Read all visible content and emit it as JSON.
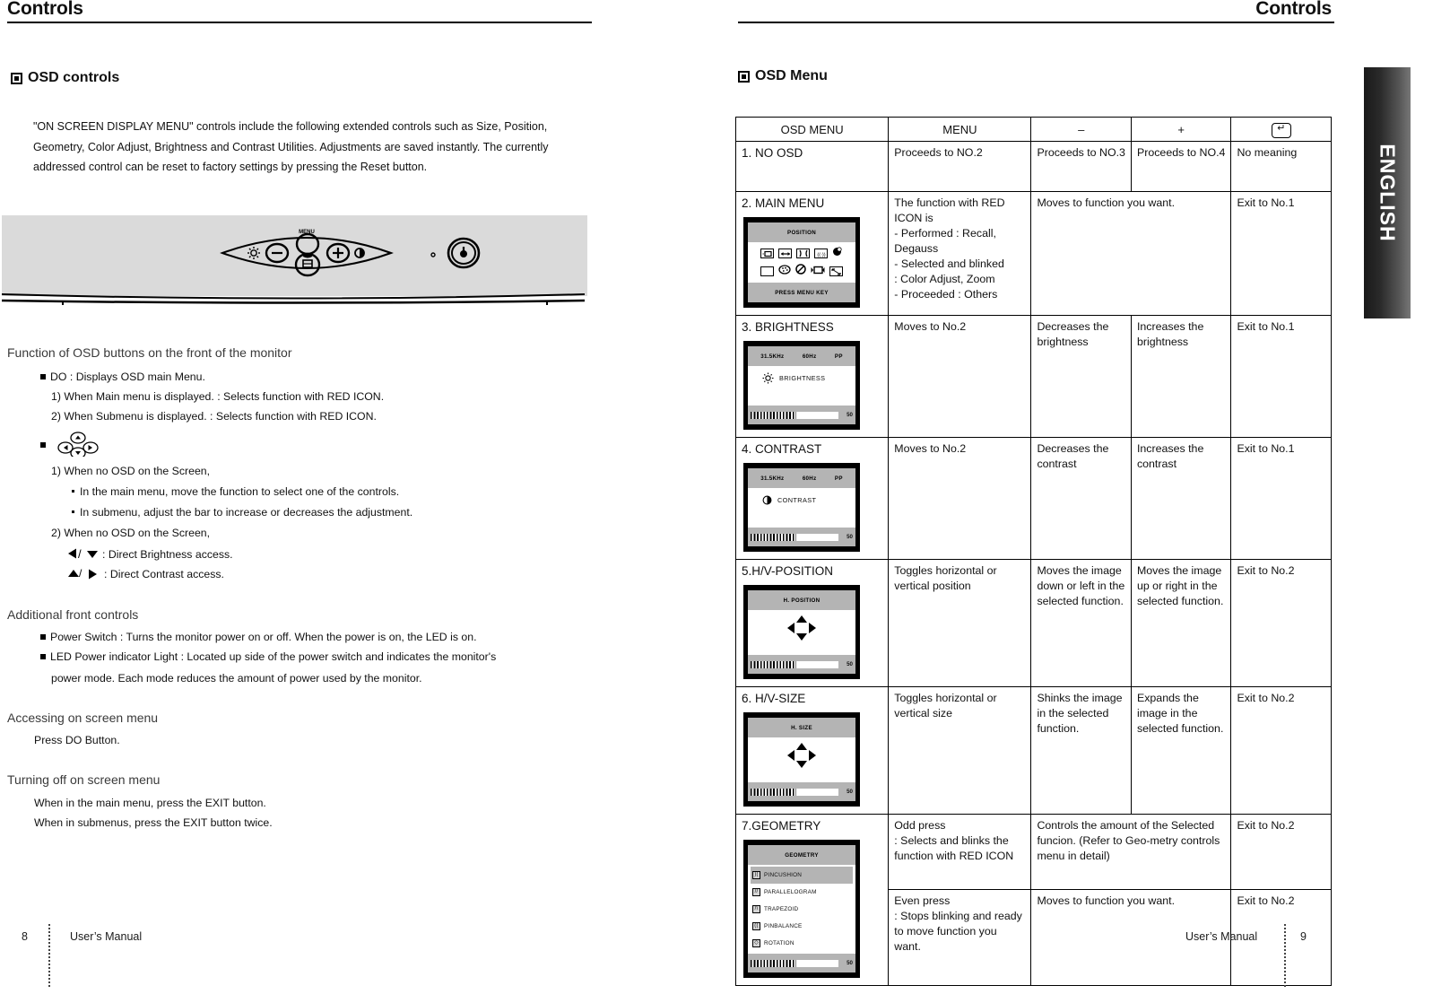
{
  "left_page": {
    "running_head": "Controls",
    "section_title": "OSD controls",
    "intro_paragraph": "\"ON SCREEN DISPLAY MENU\" controls include the following extended controls such as Size, Position, Geometry, Color Adjust, Brightness and Contrast Utilities.  Adjustments are saved instantly. The currently addressed control can be reset to factory settings by pressing the Reset button.",
    "illustration": {
      "menu_label": "MENU",
      "brightness_icon": "sun-icon",
      "minus_icon": "minus-icon",
      "do_icon": "do-button-icon",
      "plus_icon": "plus-icon",
      "contrast_icon": "contrast-icon",
      "led_icon": "led-indicator-icon",
      "power_icon": "power-icon"
    },
    "groups": [
      {
        "heading": "Function of OSD buttons on the front of the monitor",
        "lines": [
          "DO : Displays OSD main Menu.",
          "1) When Main menu is displayed. : Selects function with RED ICON.",
          "2) When Submenu is displayed. : Selects function with RED ICON.",
          "1) When no OSD on the Screen,",
          "In the main menu, move the function to select one of the controls.",
          "In submenu, adjust the bar to increase or decreases the adjustment.",
          "2) When no OSD on the Screen,",
          ": Direct Brightness access.",
          ": Direct Contrast  access."
        ]
      },
      {
        "heading": "Additional front controls",
        "lines": [
          "Power Switch : Turns the monitor power on or off. When the power is on, the LED is on.",
          "LED Power indicator Light : Located up side of the power switch and indicates the monitor's",
          "power mode. Each mode reduces the amount of power used by the monitor."
        ]
      },
      {
        "heading": "Accessing on screen menu",
        "lines": [
          "Press DO Button."
        ]
      },
      {
        "heading": "Turning off on screen menu",
        "lines": [
          "When in the main menu, press the EXIT  button.",
          "When  in submenus, press the EXIT  button twice."
        ]
      }
    ],
    "footer": {
      "page_number": "8",
      "manual_label": "User’s Manual"
    }
  },
  "right_page": {
    "running_head": "Controls",
    "section_title": "OSD Menu",
    "side_tab": "ENGLISH",
    "table": {
      "headers": [
        "OSD MENU",
        "MENU",
        "–",
        "+",
        "↵"
      ],
      "rows": [
        {
          "label": "1. NO OSD",
          "menu": "Proceeds to NO.2",
          "minus": "Proceeds to NO.3",
          "plus": "Proceeds to NO.4",
          "enter": "No meaning"
        },
        {
          "label": "2. MAIN MENU",
          "menu": "The function with RED ICON is\n- Performed : Recall,\n  Degauss\n- Selected and blinked\n  : Color Adjust, Zoom\n- Proceeded : Others",
          "minus_plus_merged": "Moves to function you want.",
          "enter": "Exit to No.1",
          "osd": {
            "type": "main-menu",
            "title": "POSITION",
            "footer": "PRESS MENU KEY",
            "icons_row1": [
              "h-position-icon",
              "h-size-icon",
              "pincushion-icon",
              "trapezoid-icon",
              "degauss-icon"
            ],
            "icons_row2": [
              "v-size-icon",
              "color-adjust-icon",
              "recall-icon",
              "zoom-icon",
              "exit-icon"
            ]
          }
        },
        {
          "label": "3. BRIGHTNESS",
          "menu": "Moves to No.2",
          "minus": "Decreases the brightness",
          "plus": "Increases the brightness",
          "enter": "Exit to No.1",
          "osd": {
            "type": "slider",
            "status": [
              "31.5KHz",
              "60Hz",
              "PP"
            ],
            "icon": "sun-icon",
            "label": "BRIGHTNESS",
            "value": "50"
          }
        },
        {
          "label": "4. CONTRAST",
          "menu": "Moves to No.2",
          "minus": "Decreases the contrast",
          "plus": "Increases the contrast",
          "enter": "Exit to No.1",
          "osd": {
            "type": "slider",
            "status": [
              "31.5KHz",
              "60Hz",
              "PP"
            ],
            "icon": "contrast-icon",
            "label": "CONTRAST",
            "value": "50"
          }
        },
        {
          "label": "5.H/V-POSITION",
          "menu": "Toggles horizontal or vertical position",
          "minus": "Moves the image down or left in the selected function.",
          "plus": "Moves the image up or right in the selected function.",
          "enter": "Exit to No.2",
          "osd": {
            "type": "arrows",
            "title": "H. POSITION",
            "value": "50"
          }
        },
        {
          "label": "6. H/V-SIZE",
          "menu": "Toggles horizontal or vertical size",
          "minus": "Shinks the image in the selected function.",
          "plus": "Expands the image in the selected function.",
          "enter": "Exit to No.2",
          "osd": {
            "type": "arrows",
            "title": "H. SIZE",
            "value": "50"
          }
        },
        {
          "label": "7.GEOMETRY",
          "menu_a": "Odd press\n: Selects and blinks the function with RED ICON",
          "minus_a": "Controls the amount of the Selected funcion. (Refer to Geo-metry controls menu in detail)",
          "enter_a": "Exit to No.2",
          "menu_b": "Even press\n: Stops blinking and ready to move function you want.",
          "minus_b": "Moves to function you want.",
          "enter_b": "Exit to No.2",
          "osd": {
            "type": "list",
            "title": "GEOMETRY",
            "items": [
              "PINCUSHION",
              "PARALLELOGRAM",
              "TRAPEZOID",
              "PINBALANCE",
              "ROTATION"
            ],
            "selected_index": 0,
            "value": "50"
          }
        }
      ]
    },
    "footer": {
      "manual_label": "User’s Manual",
      "page_number": "9"
    }
  }
}
